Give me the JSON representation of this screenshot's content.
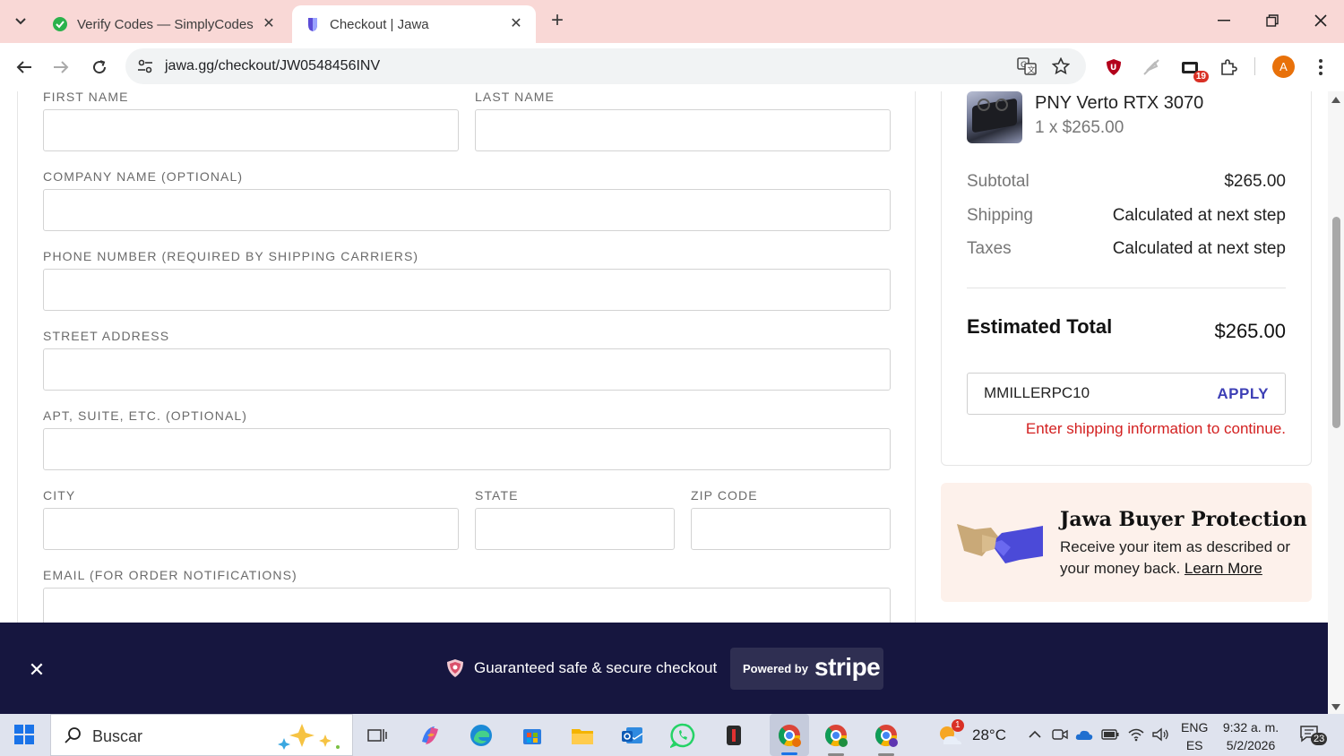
{
  "browser": {
    "tabs": [
      {
        "title": "Verify Codes — SimplyCodes",
        "active": false
      },
      {
        "title": "Checkout | Jawa",
        "active": true
      }
    ],
    "url": "jawa.gg/checkout/JW0548456INV",
    "extension_badge": "19",
    "profile_initial": "A"
  },
  "form": {
    "first_name_label": "FIRST NAME",
    "last_name_label": "LAST NAME",
    "company_label": "COMPANY NAME (OPTIONAL)",
    "phone_label": "PHONE NUMBER (REQUIRED BY SHIPPING CARRIERS)",
    "street_label": "STREET ADDRESS",
    "apt_label": "APT, SUITE, ETC. (OPTIONAL)",
    "city_label": "CITY",
    "state_label": "STATE",
    "zip_label": "ZIP CODE",
    "email_label": "EMAIL (FOR ORDER NOTIFICATIONS)"
  },
  "summary": {
    "product_name": "PNY Verto RTX 3070",
    "product_qty": "1 x  $265.00",
    "rows": [
      {
        "label": "Subtotal",
        "value": "$265.00"
      },
      {
        "label": "Shipping",
        "value": "Calculated at next step"
      },
      {
        "label": "Taxes",
        "value": "Calculated at next step"
      }
    ],
    "total_label": "Estimated Total",
    "total_value": "$265.00",
    "coupon_value": "MMILLERPC10",
    "apply_label": "APPLY",
    "error": "Enter shipping information to continue."
  },
  "protection": {
    "title": "Jawa Buyer Protection",
    "text": "Receive your item as described or your money back.",
    "link": "Learn More"
  },
  "secure_bar": {
    "text": "Guaranteed safe & secure checkout",
    "powered_by": "Powered by",
    "brand": "stripe"
  },
  "taskbar": {
    "search_placeholder": "Buscar",
    "weather": "28°C",
    "weather_badge": "1",
    "lang_top": "ENG",
    "lang_bottom": "ES",
    "time": "9:32 a. m.",
    "date": "5/2/2026",
    "notifications": "23"
  },
  "colors": {
    "accent": "#3d3fb5",
    "error": "#d32020",
    "secure_bar_bg": "#16163f",
    "tabstrip_bg": "#f9d8d6"
  }
}
